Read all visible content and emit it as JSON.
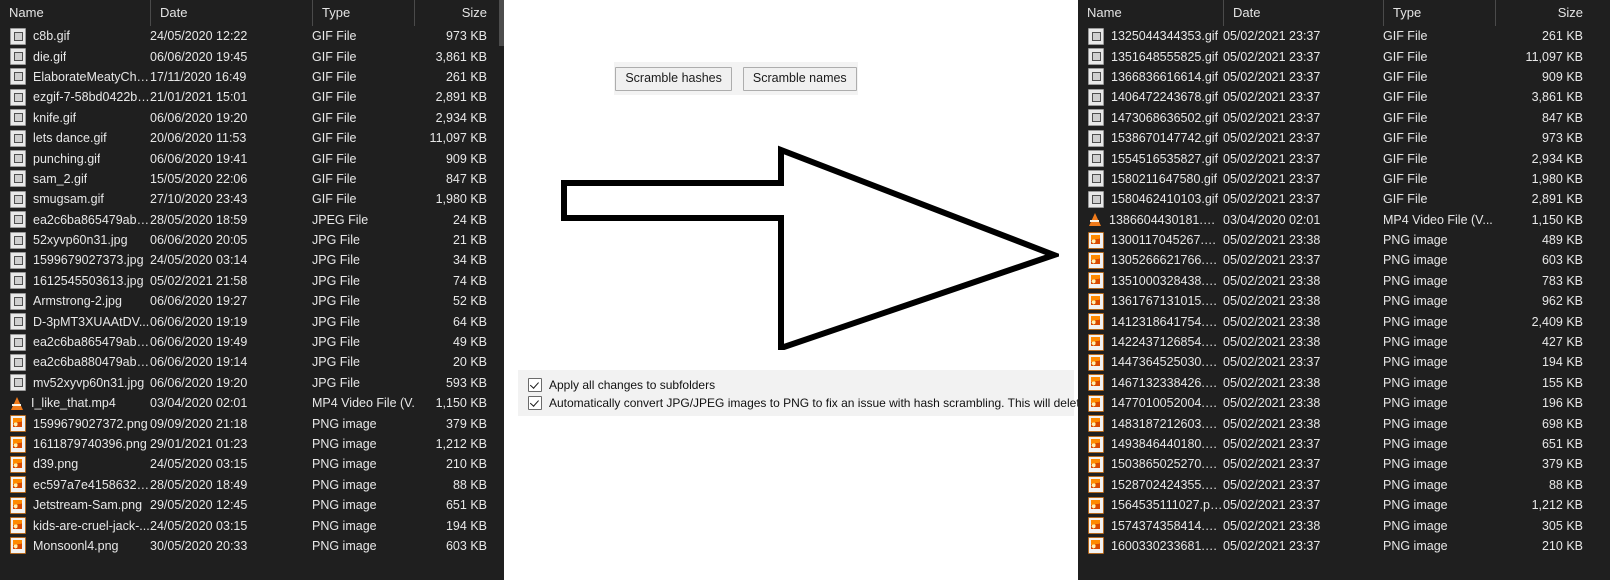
{
  "left_pane": {
    "columns": [
      {
        "label": "Name",
        "sorted": false
      },
      {
        "label": "Date",
        "sorted": false
      },
      {
        "label": "Type",
        "sorted": true
      },
      {
        "label": "Size",
        "sorted": false
      }
    ],
    "sort_caret": "⌃",
    "rows": [
      {
        "icon": "gif-file-icon",
        "name": "c8b.gif",
        "date": "24/05/2020 12:22",
        "type": "GIF File",
        "size": "973 KB"
      },
      {
        "icon": "gif-file-icon",
        "name": "die.gif",
        "date": "06/06/2020 19:45",
        "type": "GIF File",
        "size": "3,861 KB"
      },
      {
        "icon": "gif-file-icon",
        "name": "ElaborateMeatyChe...",
        "date": "17/11/2020 16:49",
        "type": "GIF File",
        "size": "261 KB"
      },
      {
        "icon": "gif-file-icon",
        "name": "ezgif-7-58bd0422b8...",
        "date": "21/01/2021 15:01",
        "type": "GIF File",
        "size": "2,891 KB"
      },
      {
        "icon": "gif-file-icon",
        "name": "knife.gif",
        "date": "06/06/2020 19:20",
        "type": "GIF File",
        "size": "2,934 KB"
      },
      {
        "icon": "gif-file-icon",
        "name": "lets dance.gif",
        "date": "20/06/2020 11:53",
        "type": "GIF File",
        "size": "11,097 KB"
      },
      {
        "icon": "gif-file-icon",
        "name": "punching.gif",
        "date": "06/06/2020 19:41",
        "type": "GIF File",
        "size": "909 KB"
      },
      {
        "icon": "gif-file-icon",
        "name": "sam_2.gif",
        "date": "15/05/2020 22:06",
        "type": "GIF File",
        "size": "847 KB"
      },
      {
        "icon": "gif-file-icon",
        "name": "smugsam.gif",
        "date": "27/10/2020 23:43",
        "type": "GIF File",
        "size": "1,980 KB"
      },
      {
        "icon": "jpeg-file-icon",
        "name": "ea2c6ba865479abe5...",
        "date": "28/05/2020 18:59",
        "type": "JPEG File",
        "size": "24 KB"
      },
      {
        "icon": "jpg-file-icon",
        "name": "52xyvp60n31.jpg",
        "date": "06/06/2020 20:05",
        "type": "JPG File",
        "size": "21 KB"
      },
      {
        "icon": "jpg-file-icon",
        "name": "1599679027373.jpg",
        "date": "24/05/2020 03:14",
        "type": "JPG File",
        "size": "34 KB"
      },
      {
        "icon": "jpg-file-icon",
        "name": "1612545503613.jpg",
        "date": "05/02/2021 21:58",
        "type": "JPG File",
        "size": "74 KB"
      },
      {
        "icon": "jpg-file-icon",
        "name": "Armstrong-2.jpg",
        "date": "06/06/2020 19:27",
        "type": "JPG File",
        "size": "52 KB"
      },
      {
        "icon": "jpg-file-icon",
        "name": "D-3pMT3XUAAtDV...",
        "date": "06/06/2020 19:19",
        "type": "JPG File",
        "size": "64 KB"
      },
      {
        "icon": "jpg-file-icon",
        "name": "ea2c6ba865479abe5...",
        "date": "06/06/2020 19:49",
        "type": "JPG File",
        "size": "49 KB"
      },
      {
        "icon": "jpg-file-icon",
        "name": "ea2c6ba880479abe5...",
        "date": "06/06/2020 19:14",
        "type": "JPG File",
        "size": "20 KB"
      },
      {
        "icon": "jpg-file-icon",
        "name": "mv52xyvp60n31.jpg",
        "date": "06/06/2020 19:20",
        "type": "JPG File",
        "size": "593 KB"
      },
      {
        "icon": "mp4-vlc-icon",
        "name": "I_like_that.mp4",
        "date": "03/04/2020 02:01",
        "type": "MP4 Video File (V...",
        "size": "1,150 KB"
      },
      {
        "icon": "png-file-icon",
        "name": "1599679027372.png",
        "date": "09/09/2020 21:18",
        "type": "PNG image",
        "size": "379 KB"
      },
      {
        "icon": "png-file-icon",
        "name": "1611879740396.png",
        "date": "29/01/2021 01:23",
        "type": "PNG image",
        "size": "1,212 KB"
      },
      {
        "icon": "png-file-icon",
        "name": "d39.png",
        "date": "24/05/2020 03:15",
        "type": "PNG image",
        "size": "210 KB"
      },
      {
        "icon": "png-file-icon",
        "name": "ec597a7e415863206...",
        "date": "28/05/2020 18:49",
        "type": "PNG image",
        "size": "88 KB"
      },
      {
        "icon": "png-file-icon",
        "name": "Jetstream-Sam.png",
        "date": "29/05/2020 12:45",
        "type": "PNG image",
        "size": "651 KB"
      },
      {
        "icon": "png-file-icon",
        "name": "kids-are-cruel-jack-...",
        "date": "24/05/2020 03:15",
        "type": "PNG image",
        "size": "194 KB"
      },
      {
        "icon": "png-file-icon",
        "name": "Monsoonl4.png",
        "date": "30/05/2020 20:33",
        "type": "PNG image",
        "size": "603 KB"
      }
    ]
  },
  "right_pane": {
    "columns": [
      {
        "label": "Name",
        "sorted": false
      },
      {
        "label": "Date",
        "sorted": false
      },
      {
        "label": "Type",
        "sorted": false
      },
      {
        "label": "Size",
        "sorted": false
      }
    ],
    "rows": [
      {
        "icon": "gif-file-icon",
        "name": "1325044344353.gif",
        "date": "05/02/2021 23:37",
        "type": "GIF File",
        "size": "261 KB"
      },
      {
        "icon": "gif-file-icon",
        "name": "1351648555825.gif",
        "date": "05/02/2021 23:37",
        "type": "GIF File",
        "size": "11,097 KB"
      },
      {
        "icon": "gif-file-icon",
        "name": "1366836616614.gif",
        "date": "05/02/2021 23:37",
        "type": "GIF File",
        "size": "909 KB"
      },
      {
        "icon": "gif-file-icon",
        "name": "1406472243678.gif",
        "date": "05/02/2021 23:37",
        "type": "GIF File",
        "size": "3,861 KB"
      },
      {
        "icon": "gif-file-icon",
        "name": "1473068636502.gif",
        "date": "05/02/2021 23:37",
        "type": "GIF File",
        "size": "847 KB"
      },
      {
        "icon": "gif-file-icon",
        "name": "1538670147742.gif",
        "date": "05/02/2021 23:37",
        "type": "GIF File",
        "size": "973 KB"
      },
      {
        "icon": "gif-file-icon",
        "name": "1554516535827.gif",
        "date": "05/02/2021 23:37",
        "type": "GIF File",
        "size": "2,934 KB"
      },
      {
        "icon": "gif-file-icon",
        "name": "1580211647580.gif",
        "date": "05/02/2021 23:37",
        "type": "GIF File",
        "size": "1,980 KB"
      },
      {
        "icon": "gif-file-icon",
        "name": "1580462410103.gif",
        "date": "05/02/2021 23:37",
        "type": "GIF File",
        "size": "2,891 KB"
      },
      {
        "icon": "mp4-vlc-icon",
        "name": "1386604430181.mp4",
        "date": "03/04/2020 02:01",
        "type": "MP4 Video File (V...",
        "size": "1,150 KB"
      },
      {
        "icon": "png-file-icon",
        "name": "1300117045267.png",
        "date": "05/02/2021 23:38",
        "type": "PNG image",
        "size": "489 KB"
      },
      {
        "icon": "png-file-icon",
        "name": "1305266621766.png",
        "date": "05/02/2021 23:37",
        "type": "PNG image",
        "size": "603 KB"
      },
      {
        "icon": "png-file-icon",
        "name": "1351000328438.png",
        "date": "05/02/2021 23:38",
        "type": "PNG image",
        "size": "783 KB"
      },
      {
        "icon": "png-file-icon",
        "name": "1361767131015.png",
        "date": "05/02/2021 23:38",
        "type": "PNG image",
        "size": "962 KB"
      },
      {
        "icon": "png-file-icon",
        "name": "1412318641754.png",
        "date": "05/02/2021 23:38",
        "type": "PNG image",
        "size": "2,409 KB"
      },
      {
        "icon": "png-file-icon",
        "name": "1422437126854.png",
        "date": "05/02/2021 23:38",
        "type": "PNG image",
        "size": "427 KB"
      },
      {
        "icon": "png-file-icon",
        "name": "1447364525030.png",
        "date": "05/02/2021 23:37",
        "type": "PNG image",
        "size": "194 KB"
      },
      {
        "icon": "png-file-icon",
        "name": "1467132338426.png",
        "date": "05/02/2021 23:38",
        "type": "PNG image",
        "size": "155 KB"
      },
      {
        "icon": "png-file-icon",
        "name": "1477010052004.png",
        "date": "05/02/2021 23:38",
        "type": "PNG image",
        "size": "196 KB"
      },
      {
        "icon": "png-file-icon",
        "name": "1483187212603.png",
        "date": "05/02/2021 23:38",
        "type": "PNG image",
        "size": "698 KB"
      },
      {
        "icon": "png-file-icon",
        "name": "1493846440180.png",
        "date": "05/02/2021 23:37",
        "type": "PNG image",
        "size": "651 KB"
      },
      {
        "icon": "png-file-icon",
        "name": "1503865025270.png",
        "date": "05/02/2021 23:37",
        "type": "PNG image",
        "size": "379 KB"
      },
      {
        "icon": "png-file-icon",
        "name": "1528702424355.png",
        "date": "05/02/2021 23:37",
        "type": "PNG image",
        "size": "88 KB"
      },
      {
        "icon": "png-file-icon",
        "name": "1564535111027.png",
        "date": "05/02/2021 23:37",
        "type": "PNG image",
        "size": "1,212 KB"
      },
      {
        "icon": "png-file-icon",
        "name": "1574374358414.png",
        "date": "05/02/2021 23:38",
        "type": "PNG image",
        "size": "305 KB"
      },
      {
        "icon": "png-file-icon",
        "name": "1600330233681.png",
        "date": "05/02/2021 23:37",
        "type": "PNG image",
        "size": "210 KB"
      }
    ]
  },
  "center_app": {
    "buttons": {
      "scramble_hashes": "Scramble hashes",
      "scramble_names": "Scramble names"
    },
    "arrow": {
      "icon": "right-arrow-icon",
      "stroke_color": "#000000",
      "fill_color": "#ffffff"
    },
    "options": {
      "apply_subfolders": {
        "label": "Apply all changes to subfolders",
        "checked": true
      },
      "auto_convert": {
        "label": "Automatically convert JPG/JPEG images to PNG to fix an issue with hash scrambling. This will delete the old file",
        "checked": true
      }
    }
  },
  "colors": {
    "explorer_background": "#1f1f1f",
    "explorer_text": "#e8e8e8",
    "app_background": "#ffffff",
    "panel_background": "#f2f2f2",
    "button_face": "#f0f0f0"
  }
}
